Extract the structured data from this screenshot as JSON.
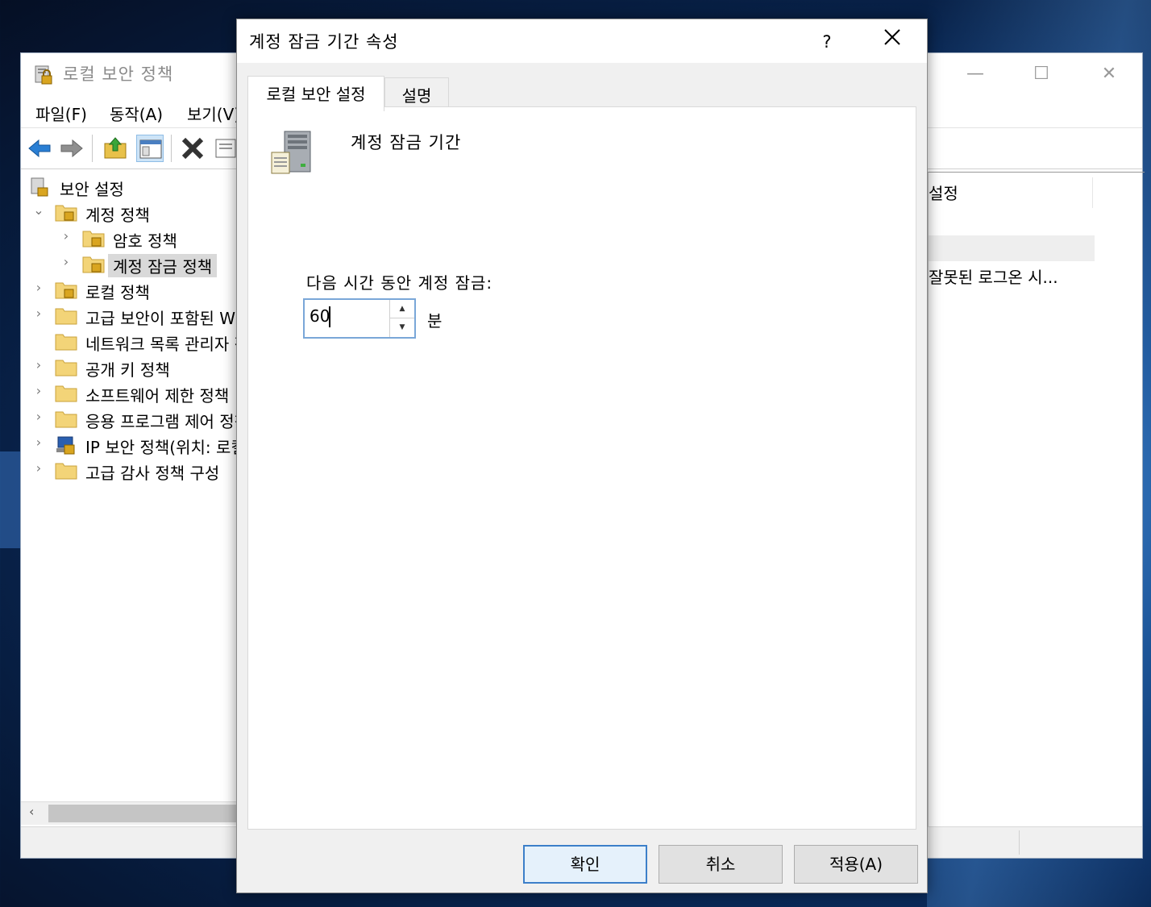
{
  "main_window": {
    "title": "로컬 보안 정책",
    "menu": [
      "파일(F)",
      "동작(A)",
      "보기(V)"
    ],
    "tree": [
      {
        "label": "보안 설정",
        "level": 0,
        "chevron": ""
      },
      {
        "label": "계정 정책",
        "level": 1,
        "chevron": "⌄"
      },
      {
        "label": "암호 정책",
        "level": 2,
        "chevron": "›"
      },
      {
        "label": "계정 잠금 정책",
        "level": 2,
        "chevron": "›"
      },
      {
        "label": "로컬 정책",
        "level": 1,
        "chevron": "›"
      },
      {
        "label": "고급 보안이 포함된 Windows Defender 방화벽",
        "level": 1,
        "chevron": "›"
      },
      {
        "label": "네트워크 목록 관리자 정책",
        "level": 1,
        "chevron": ""
      },
      {
        "label": "공개 키 정책",
        "level": 1,
        "chevron": "›"
      },
      {
        "label": "소프트웨어 제한 정책",
        "level": 1,
        "chevron": "›"
      },
      {
        "label": "응용 프로그램 제어 정책",
        "level": 1,
        "chevron": "›"
      },
      {
        "label": "IP 보안 정책(위치: 로컬 컴퓨터)",
        "level": 1,
        "chevron": "›"
      },
      {
        "label": "고급 감사 정책 구성",
        "level": 1,
        "chevron": "›"
      }
    ],
    "right_pane": {
      "column_header": "설정",
      "row": "잘못된 로그온 시..."
    }
  },
  "dialog": {
    "title": "계정 잠금 기간 속성",
    "help": "?",
    "tabs": [
      "로컬 보안 설정",
      "설명"
    ],
    "policy_name": "계정 잠금 기간",
    "field_label": "다음 시간 동안 계정 잠금:",
    "field_value": "60",
    "unit": "분",
    "buttons": {
      "ok": "확인",
      "cancel": "취소",
      "apply": "적용(A)"
    }
  }
}
